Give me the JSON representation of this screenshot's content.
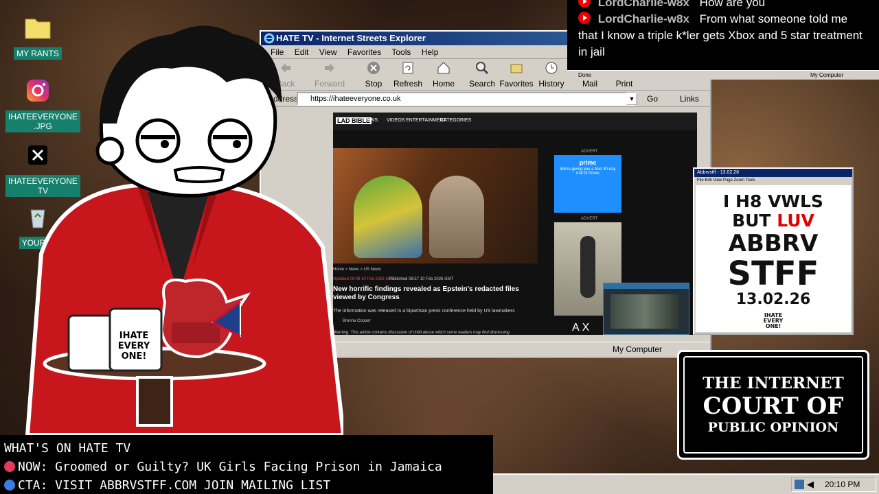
{
  "desktop": {
    "icons": [
      {
        "label": "MY RANTS",
        "icon": "folder-icon"
      },
      {
        "label": "IHATEEVERYONE\n.JPG",
        "icon": "instagram-icon"
      },
      {
        "label": "IHATEEVERYONE\nTV",
        "icon": "x-icon"
      },
      {
        "label": "YOUR C",
        "icon": "recycle-bin-icon"
      }
    ]
  },
  "chat": {
    "partial_user": "LordCharlie-w8x",
    "partial_message": "How are you",
    "user": "LordCharlie-w8x",
    "message": "From what someone told me that I know a triple k*ler gets Xbox and 5 star treatment in jail",
    "status_left": "Done",
    "status_right": "My Computer"
  },
  "browser": {
    "title": "HATE TV - Internet Streets Explorer",
    "menu": [
      "File",
      "Edit",
      "View",
      "Favorites",
      "Tools",
      "Help"
    ],
    "toolbar": [
      {
        "label": "Back",
        "icon": "back-arrow-icon",
        "enabled": false
      },
      {
        "label": "Forward",
        "icon": "forward-arrow-icon",
        "enabled": false
      },
      {
        "label": "Stop",
        "icon": "stop-icon",
        "enabled": true
      },
      {
        "label": "Refresh",
        "icon": "refresh-icon",
        "enabled": true
      },
      {
        "label": "Home",
        "icon": "home-icon",
        "enabled": true
      },
      {
        "label": "Search",
        "icon": "search-icon",
        "enabled": true
      },
      {
        "label": "Favorites",
        "icon": "favorites-icon",
        "enabled": true
      },
      {
        "label": "History",
        "icon": "history-icon",
        "enabled": true
      },
      {
        "label": "Mail",
        "icon": "mail-icon",
        "enabled": true
      },
      {
        "label": "Print",
        "icon": "print-icon",
        "enabled": true
      }
    ],
    "address_label": "Address",
    "url": "https://ihateeveryone.co.uk",
    "go_label": "Go",
    "links_label": "Links",
    "status_zone": "My Computer"
  },
  "webpage": {
    "site_name": "LAD BIBLE",
    "nav": [
      "NEWS",
      "VIDEOS",
      "ENTERTAINMENT",
      "CATEGORIES"
    ],
    "breadcrumb": "Home > News > US News",
    "updated": "Updated 09:09 10 Feb 2026 GMT",
    "published": "Published 08:57 10 Feb 2026 GMT",
    "headline": "New horrific findings revealed as Epstein's redacted files viewed by Congress",
    "standfirst": "The information was released in a bipartisan press conference held by US lawmakers",
    "author": "Brenna Cooper",
    "warning": "Warning: This article contains discussion of child abuse which some readers may find distressing",
    "advert_label": "ADVERT",
    "prime_brand": "prime",
    "prime_text": "We're giving you a free 30-day trial of Prime",
    "ad_brand": "AX"
  },
  "poster_window": {
    "title": "Abbrvstff - 13.02.26",
    "menu": [
      "File",
      "Edit",
      "View",
      "Page",
      "Zoom",
      "Tools"
    ],
    "line1": "I H8 VWLS",
    "line2a": "BUT",
    "line2b": "LUV",
    "line3": "ABBRV",
    "line4": "STFF",
    "date": "13.02.26",
    "logo": "IHATE\nEVERY\nONE!"
  },
  "court": {
    "line1": "THE INTERNET",
    "line2": "COURT OF",
    "line3": "PUBLIC OPINION"
  },
  "ticker": {
    "heading": "WHAT'S ON HATE TV",
    "now": "NOW: Groomed or Guilty? UK Girls Facing Prison in Jamaica",
    "cta": "CTA: VISIT ABBRVSTFF.COM JOIN MAILING LIST"
  },
  "mug": {
    "text": "IHATE\nEVERY\nONE!"
  },
  "taskbar": {
    "time": "20:10 PM"
  },
  "colors": {
    "title_blue": "#0a246a",
    "icon_label_bg": "#17806d",
    "accent_red": "#e00000",
    "jacket_red": "#c8161d"
  }
}
